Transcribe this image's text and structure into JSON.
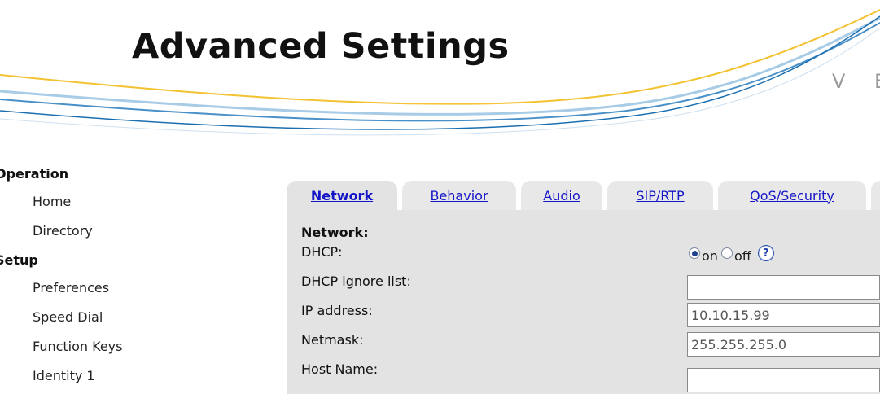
{
  "header": {
    "title": "Advanced Settings",
    "brand": "V E",
    "swoosh_colors": [
      "#f2c230",
      "#4a90c8",
      "#a8cbe6",
      "#1b6fb0"
    ]
  },
  "sidebar": {
    "sections": [
      {
        "label": "Operation",
        "items": [
          "Home",
          "Directory"
        ]
      },
      {
        "label": "Setup",
        "items": [
          "Preferences",
          "Speed Dial",
          "Function Keys",
          "Identity 1"
        ]
      }
    ]
  },
  "tabs": {
    "items": [
      "Network",
      "Behavior",
      "Audio",
      "SIP/RTP",
      "QoS/Security"
    ],
    "active": "Network"
  },
  "network": {
    "section_title": "Network:",
    "dhcp": {
      "label": "DHCP:",
      "selected": "on",
      "on_label": "on",
      "off_label": "off",
      "help_icon": "?"
    },
    "dhcp_ignore_list": {
      "label": "DHCP ignore list:",
      "value": ""
    },
    "ip_address": {
      "label": "IP address:",
      "value": "10.10.15.99"
    },
    "netmask": {
      "label": "Netmask:",
      "value": "255.255.255.0"
    },
    "host_name": {
      "label": "Host Name:",
      "value": ""
    }
  },
  "colors": {
    "link": "#1515c8",
    "panel_bg": "#e3e3e3",
    "tab_bg": "#e8e8e8"
  }
}
